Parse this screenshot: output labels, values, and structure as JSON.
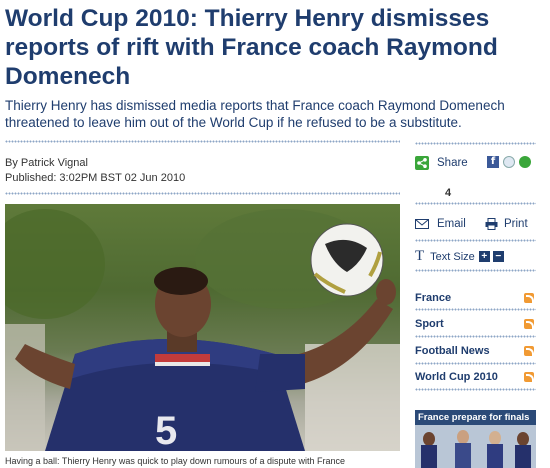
{
  "article": {
    "headline": "World Cup 2010: Thierry Henry dismisses reports of rift with France coach Raymond Domenech",
    "standfirst": "Thierry Henry has dismissed media reports that France coach Raymond Domenech threatened to leave him out of the World Cup if he refused to be a substitute.",
    "byline": "By Patrick Vignal",
    "published": "Published: 3:02PM BST 02 Jun 2010",
    "caption": "Having a ball: Thierry Henry was quick to play down rumours of a dispute with France"
  },
  "sidebar": {
    "share_label": "Share",
    "share_count": "4",
    "email_label": "Email",
    "print_label": "Print",
    "text_size_label": "Text Size",
    "text_size_plus": "+",
    "text_size_minus": "−",
    "topics": [
      "France",
      "Sport",
      "Football News",
      "World Cup 2010"
    ],
    "promo_title": "France prepare for finals"
  },
  "colors": {
    "headline": "#1f3d6e",
    "rss": "#f19a33",
    "share_green": "#3aa63a"
  }
}
